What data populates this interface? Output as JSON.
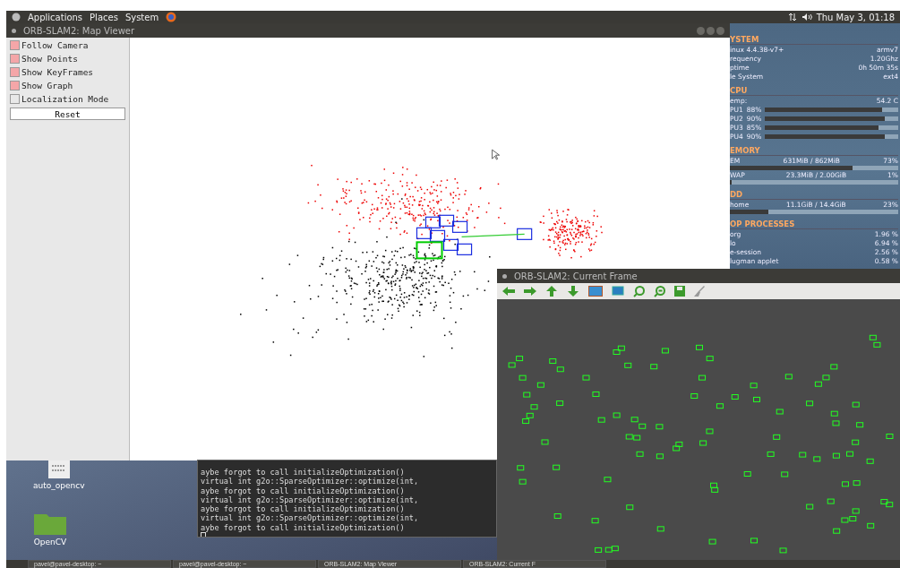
{
  "top_panel": {
    "menus": [
      "Applications",
      "Places",
      "System"
    ],
    "clock": "Thu May 3, 01:18"
  },
  "map_viewer": {
    "title": "ORB-SLAM2: Map Viewer",
    "options": [
      {
        "label": "Follow Camera",
        "checked": true
      },
      {
        "label": "Show Points",
        "checked": true
      },
      {
        "label": "Show KeyFrames",
        "checked": true
      },
      {
        "label": "Show Graph",
        "checked": true
      },
      {
        "label": "Localization Mode",
        "checked": false
      }
    ],
    "reset_button": "Reset"
  },
  "system_monitor": {
    "sections": [
      {
        "heading": "YSTEM",
        "rows": [
          {
            "label": "inux 4.4.38-v7+",
            "value": "armv7"
          },
          {
            "label": "requency",
            "value": "1.20Ghz"
          },
          {
            "label": "ptime",
            "value": "0h 50m 35s"
          },
          {
            "label": "le System",
            "value": "ext4"
          }
        ]
      },
      {
        "heading": "CPU",
        "rows": [
          {
            "label": "emp:",
            "value": "54.2 C"
          }
        ],
        "meters": [
          {
            "label": "PU1",
            "reading": "88%",
            "level": 0.88
          },
          {
            "label": "PU2",
            "reading": "90%",
            "level": 0.9
          },
          {
            "label": "PU3",
            "reading": "85%",
            "level": 0.85
          },
          {
            "label": "PU4",
            "reading": "90%",
            "level": 0.9
          }
        ]
      },
      {
        "heading": "EMORY",
        "usage": [
          {
            "label": "EM",
            "amount": "631MiB  / 862MiB",
            "percent": "73%",
            "level": 0.73
          },
          {
            "label": "WAP",
            "amount": "23.3MiB / 2.00GiB",
            "percent": "1%",
            "level": 0.01
          }
        ]
      },
      {
        "heading": "DD",
        "usage": [
          {
            "label": "home",
            "amount": "11.1GiB / 14.4GiB",
            "percent": "23%",
            "level": 0.23
          }
        ]
      },
      {
        "heading": "OP PROCESSES",
        "rows": [
          {
            "label": "org",
            "value": "1.96 %"
          },
          {
            "label": "lo",
            "value": "6.94 %"
          },
          {
            "label": "e-session",
            "value": "2.56 %"
          },
          {
            "label": "lugman applet",
            "value": "0.58 %"
          }
        ]
      }
    ]
  },
  "terminal": {
    "lines": [
      "aybe forgot to call initializeOptimization()",
      "virtual int g2o::SparseOptimizer::optimize(int,",
      "aybe forgot to call initializeOptimization()",
      "virtual int g2o::SparseOptimizer::optimize(int,",
      "aybe forgot to call initializeOptimization()",
      "virtual int g2o::SparseOptimizer::optimize(int,",
      "aybe forgot to call initializeOptimization()"
    ]
  },
  "desktop_icons": [
    {
      "kind": "file",
      "label": "auto_opencv"
    },
    {
      "kind": "folder",
      "label": "OpenCV"
    }
  ],
  "current_frame": {
    "title": "ORB-SLAM2: Current Frame"
  },
  "taskbar": {
    "items": [
      "pavel@pavel-desktop: ~",
      "pavel@pavel-desktop: ~",
      "ORB-SLAM2: Map Viewer",
      "ORB-SLAM2: Current F"
    ]
  }
}
